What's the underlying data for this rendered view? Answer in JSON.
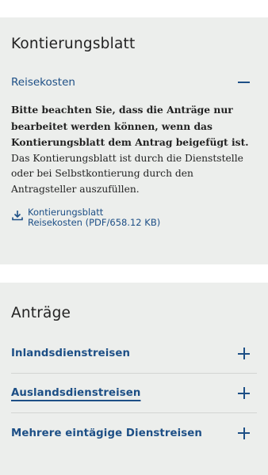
{
  "kontierung": {
    "title": "Kontierungsblatt",
    "accordion_title": "Reisekosten",
    "body_bold": "Bitte beachten Sie, dass die Anträge nur bearbeitet werden können, wenn das Kontierungsblatt dem Antrag beigefügt ist.",
    "body_normal": "Das Kontierungsblatt ist durch die Dienststelle oder bei Selbstkontierung durch den Antragsteller auszufüllen.",
    "download_line1": "Kontierungsblatt",
    "download_line2": "Reisekosten (PDF/658.12 KB)",
    "download_icon": "download-icon"
  },
  "antraege": {
    "title": "Anträge",
    "items": [
      {
        "label": "Inlandsdienstreisen",
        "icon": "plus-icon"
      },
      {
        "label": "Auslandsdienstreisen",
        "icon": "plus-icon"
      },
      {
        "label": "Mehrere eintägige Dienstreisen",
        "icon": "plus-icon"
      }
    ]
  },
  "colors": {
    "accent": "#1d4f86",
    "card_bg": "#eceeec",
    "text": "#222222"
  }
}
